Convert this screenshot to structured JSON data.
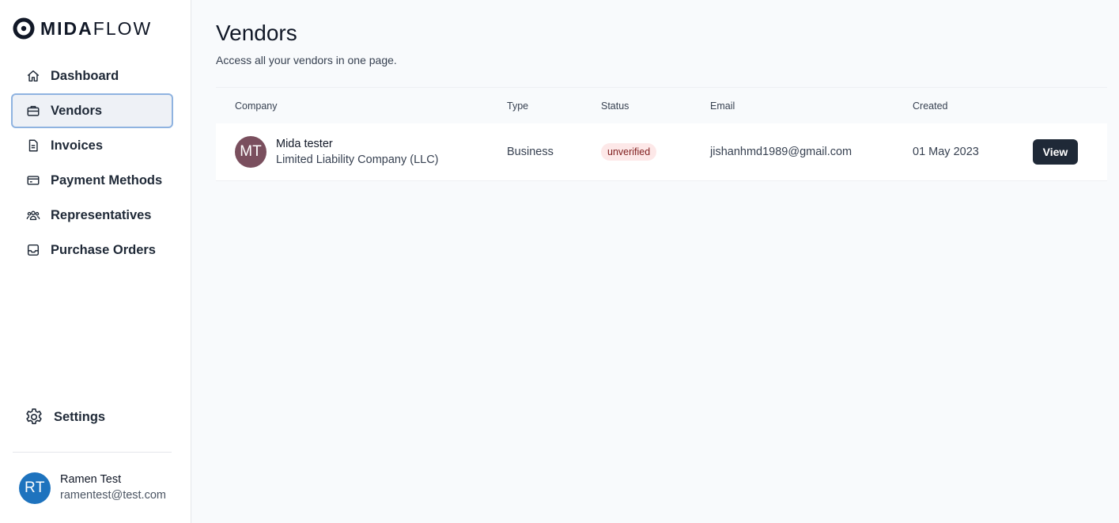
{
  "brand": {
    "name_bold": "MIDA",
    "name_light": "FLOW"
  },
  "sidebar": {
    "items": [
      {
        "label": "Dashboard",
        "icon": "home-icon"
      },
      {
        "label": "Vendors",
        "icon": "briefcase-icon",
        "active": true
      },
      {
        "label": "Invoices",
        "icon": "document-icon"
      },
      {
        "label": "Payment Methods",
        "icon": "credit-card-icon"
      },
      {
        "label": "Representatives",
        "icon": "users-icon"
      },
      {
        "label": "Purchase Orders",
        "icon": "inbox-icon"
      }
    ],
    "settings_label": "Settings"
  },
  "user": {
    "initials": "RT",
    "name": "Ramen Test",
    "email": "ramentest@test.com"
  },
  "page": {
    "title": "Vendors",
    "subtitle": "Access all your vendors in one page."
  },
  "table": {
    "headers": {
      "company": "Company",
      "type": "Type",
      "status": "Status",
      "email": "Email",
      "created": "Created"
    },
    "rows": [
      {
        "initials": "MT",
        "name": "Mida tester",
        "kind": "Limited Liability Company (LLC)",
        "type": "Business",
        "status": "unverified",
        "email": "jishanhmd1989@gmail.com",
        "created": "01 May 2023",
        "action": "View"
      }
    ]
  },
  "colors": {
    "accent": "#1f2937",
    "active_border": "#8fb3e0",
    "badge_bg": "#fde8e8",
    "badge_text": "#7f1d1d",
    "avatar_rt": "#1e73be",
    "avatar_mt": "#7a4f5e"
  }
}
